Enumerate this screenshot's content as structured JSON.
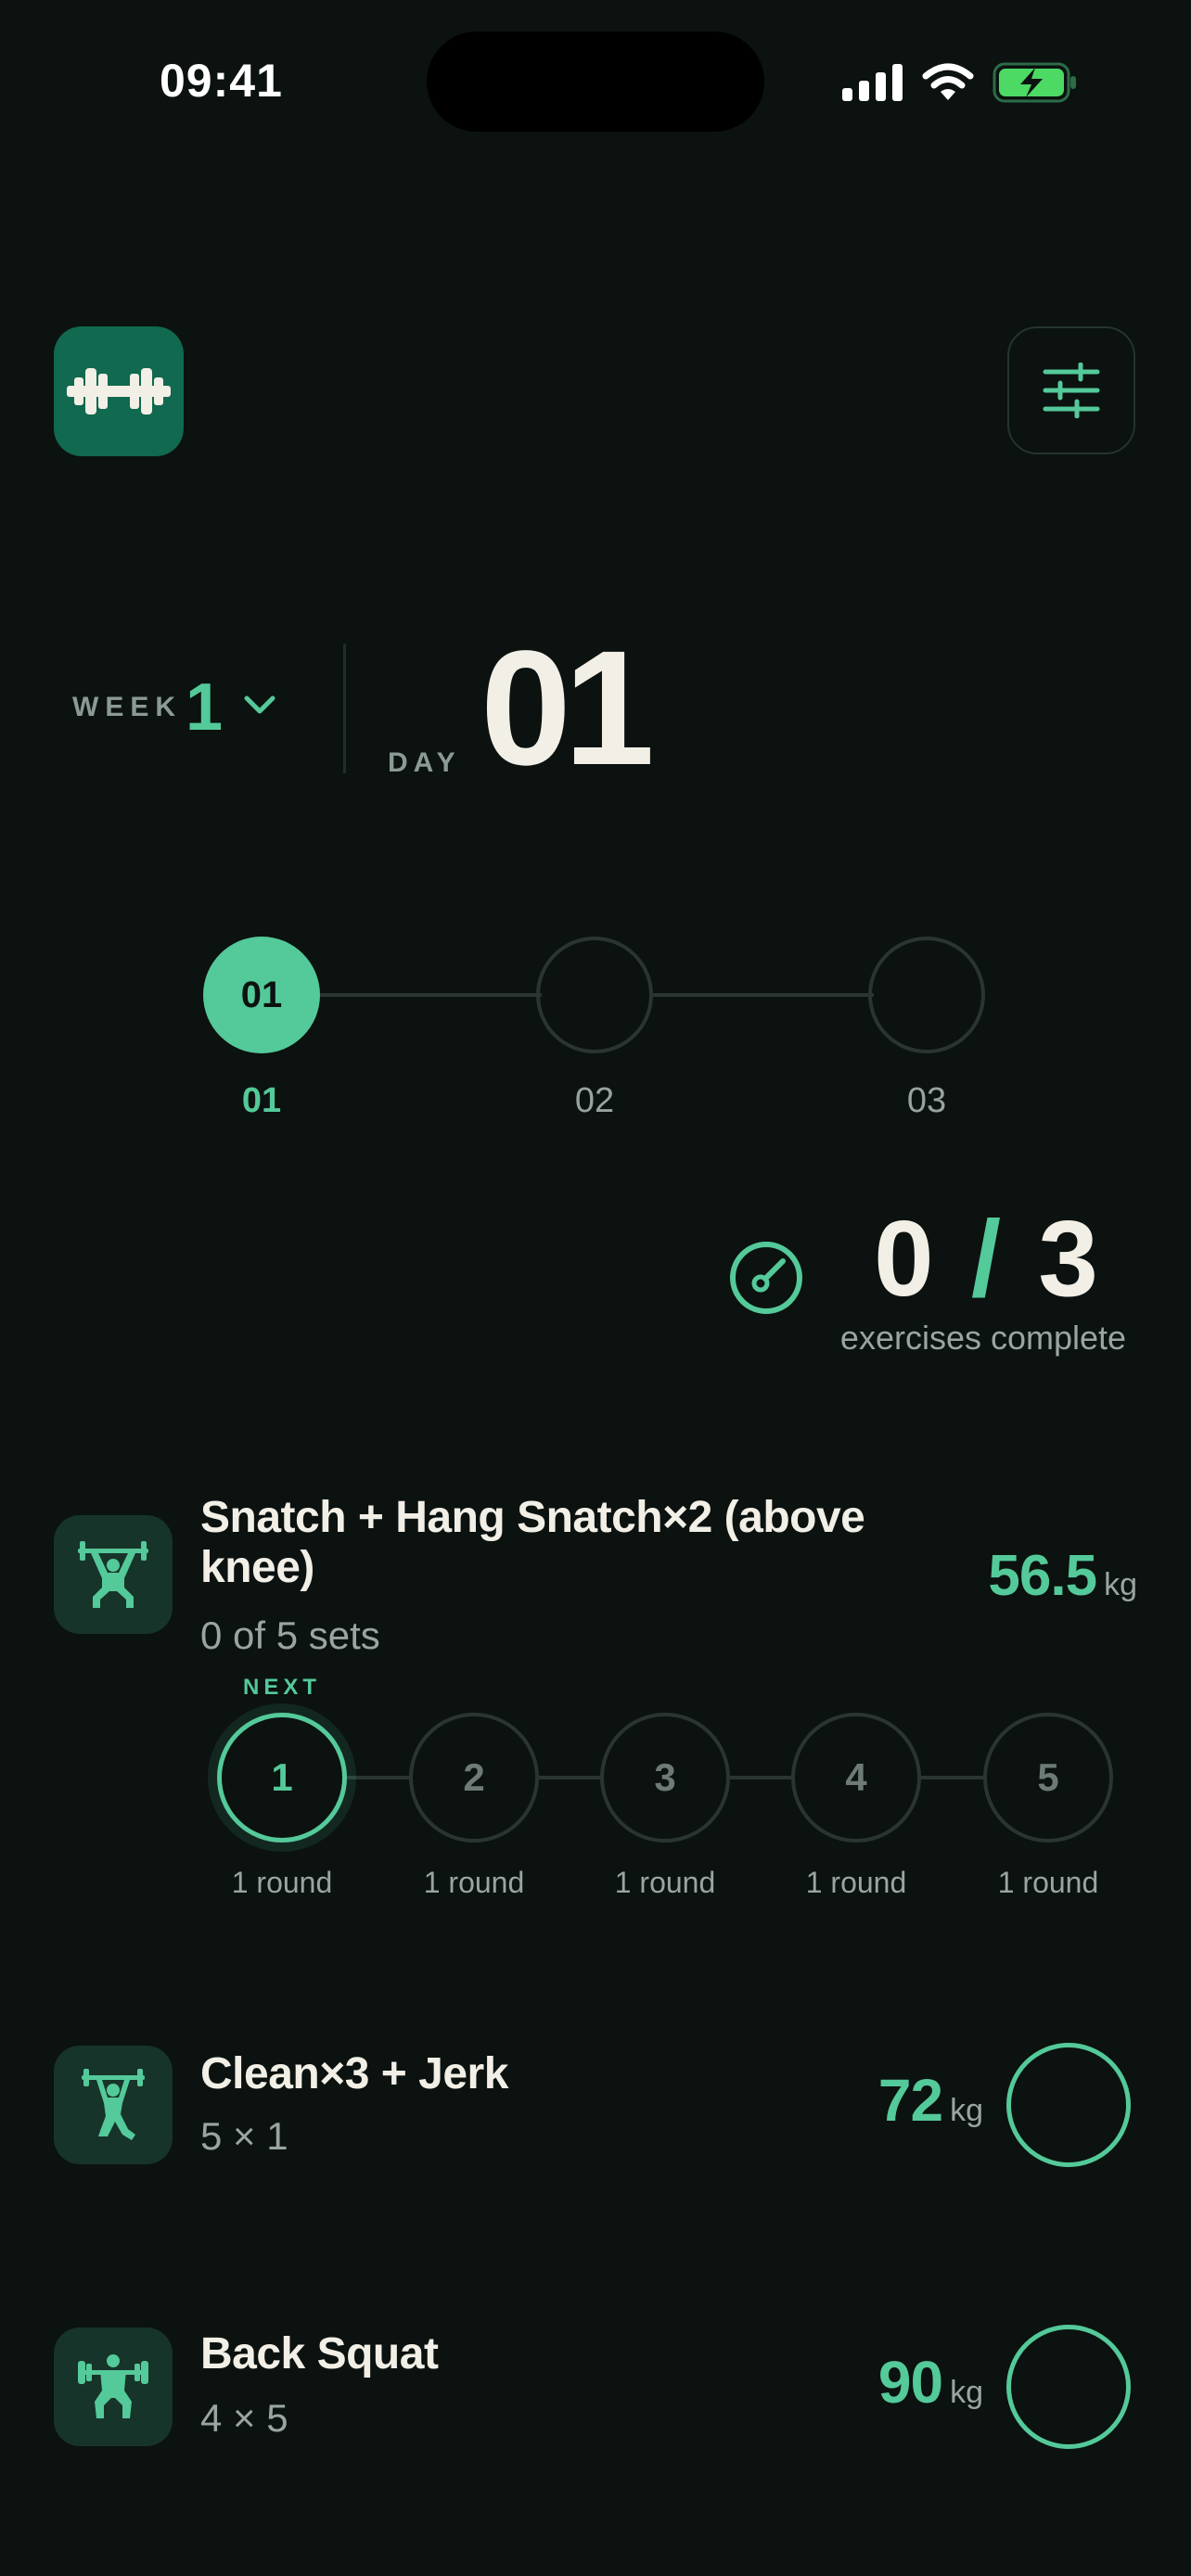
{
  "status_bar": {
    "time": "09:41"
  },
  "colors": {
    "accent": "#54c999",
    "background": "#0b1210",
    "logo_bg": "#11694f"
  },
  "header": {
    "logo_icon": "barbell-icon",
    "settings_icon": "sliders-icon"
  },
  "week": {
    "label": "WEEK",
    "value": "1"
  },
  "day": {
    "label": "DAY",
    "value": "01"
  },
  "day_stepper": [
    {
      "circle": "01",
      "label": "01",
      "active": true
    },
    {
      "circle": "",
      "label": "02",
      "active": false
    },
    {
      "circle": "",
      "label": "03",
      "active": false
    }
  ],
  "progress": {
    "done": "0",
    "slash": "/",
    "total": "3",
    "caption": "exercises complete"
  },
  "exercises": [
    {
      "title_line1": "Snatch + Hang Snatch×2 (above",
      "title_line2": "knee)",
      "subtitle": "0 of 5 sets",
      "weight": "56.5",
      "unit": "kg",
      "icon": "snatch-lifter-icon",
      "next_label": "NEXT",
      "sets": [
        {
          "num": "1",
          "label": "1 round",
          "next": true
        },
        {
          "num": "2",
          "label": "1 round",
          "next": false
        },
        {
          "num": "3",
          "label": "1 round",
          "next": false
        },
        {
          "num": "4",
          "label": "1 round",
          "next": false
        },
        {
          "num": "5",
          "label": "1 round",
          "next": false
        }
      ]
    },
    {
      "title": "Clean×3 + Jerk",
      "subtitle": "5 × 1",
      "weight": "72",
      "unit": "kg",
      "icon": "jerk-lifter-icon"
    },
    {
      "title": "Back Squat",
      "subtitle": "4 × 5",
      "weight": "90",
      "unit": "kg",
      "icon": "squat-lifter-icon"
    }
  ]
}
